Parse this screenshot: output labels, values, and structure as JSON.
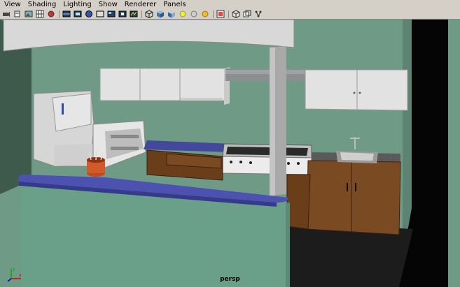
{
  "menu": [
    "View",
    "Shading",
    "Lighting",
    "Show",
    "Renderer",
    "Panels"
  ],
  "toolbar_groups": [
    [
      "camera-attributes-icon",
      "bookmark-icon",
      "image-plane-icon",
      "grid-toggle-icon",
      "snapshot-icon"
    ],
    [
      "wireframe-icon",
      "smooth-shade-icon",
      "textured-icon",
      "lights-icon",
      "shadows-icon",
      "xray-icon",
      "isolate-icon"
    ],
    [
      "cube-wire-icon",
      "cube-shaded-icon",
      "cube-textured-icon",
      "default-light-icon",
      "all-lights-icon",
      "selected-light-icon"
    ],
    [
      "resolution-gate-icon"
    ],
    [
      "film-gate-icon",
      "safe-action-icon",
      "channel-box-icon"
    ]
  ],
  "viewport": {
    "camera_label": "persp",
    "axis_x_label": "x",
    "axis_y_label": "y",
    "background_color": "#6f9a86"
  }
}
